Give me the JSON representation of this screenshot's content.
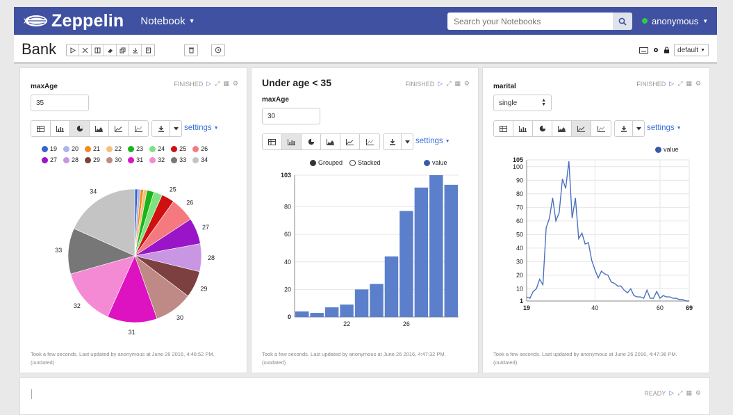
{
  "app": {
    "brand": "Zeppelin",
    "notebook_menu": "Notebook",
    "search_placeholder": "Search your Notebooks",
    "user": "anonymous"
  },
  "notebook": {
    "title": "Bank",
    "interpreter_default": "default"
  },
  "colors": {
    "navbar": "#3f51a0",
    "accent": "#3a6fd8",
    "bar": "#5b7fcb",
    "status_green": "#2ecc40"
  },
  "panels": [
    {
      "title": "",
      "status": "FINISHED",
      "form_label": "maxAge",
      "form_value": "35",
      "settings_label": "settings",
      "footer_line1": "Took a few seconds. Last updated by anonymous at June 26 2016, 4:46:52 PM.",
      "footer_line2": "(outdated)"
    },
    {
      "title": "Under age < 35",
      "status": "FINISHED",
      "form_label": "maxAge",
      "form_value": "30",
      "settings_label": "settings",
      "grouped_label": "Grouped",
      "stacked_label": "Stacked",
      "value_legend": "value",
      "footer_line1": "Took a few seconds. Last updated by anonymous at June 26 2016, 4:47:32 PM.",
      "footer_line2": "(outdated)"
    },
    {
      "title": "",
      "status": "FINISHED",
      "form_label": "marital",
      "form_value": "single",
      "settings_label": "settings",
      "value_legend": "value",
      "footer_line1": "Took a few seconds. Last updated by anonymous at June 26 2016, 4:47:36 PM.",
      "footer_line2": "(outdated)"
    }
  ],
  "bottom_panel": {
    "status": "READY"
  },
  "chart_data": [
    {
      "type": "pie",
      "categories": [
        "19",
        "20",
        "21",
        "22",
        "23",
        "24",
        "25",
        "26",
        "27",
        "28",
        "29",
        "30",
        "31",
        "32",
        "33",
        "34"
      ],
      "values": [
        0.5,
        0.5,
        0.5,
        0.6,
        1.2,
        1.5,
        2.2,
        4.2,
        4.5,
        4.8,
        4.6,
        6.6,
        8.6,
        9.9,
        7.9,
        13.0
      ],
      "colors": [
        "#3366cc",
        "#aab4ee",
        "#f28a1e",
        "#f5c07a",
        "#1ab41a",
        "#7ee37e",
        "#d01010",
        "#f57a80",
        "#9a14c8",
        "#c996e3",
        "#7c4040",
        "#bf8a85",
        "#dd12c0",
        "#f48ad4",
        "#777777",
        "#c4c4c4"
      ],
      "labels_shown": [
        "25",
        "26",
        "27",
        "28",
        "29",
        "30",
        "31",
        "32",
        "33",
        "34"
      ]
    },
    {
      "type": "bar",
      "x": [
        19,
        20,
        21,
        22,
        23,
        24,
        25,
        26,
        27,
        28,
        29
      ],
      "values": [
        4,
        3,
        7,
        9,
        20,
        24,
        44,
        77,
        94,
        103,
        96
      ],
      "ylim": [
        0,
        103
      ],
      "yticks": [
        0,
        20,
        40,
        60,
        80,
        103
      ],
      "xticks": [
        22,
        26
      ],
      "legend": "value"
    },
    {
      "type": "line",
      "x": [
        19,
        20,
        21,
        22,
        23,
        24,
        25,
        26,
        27,
        28,
        29,
        30,
        31,
        32,
        33,
        34,
        35,
        36,
        37,
        38,
        39,
        40,
        41,
        42,
        43,
        44,
        45,
        46,
        47,
        48,
        49,
        50,
        51,
        52,
        53,
        54,
        55,
        56,
        57,
        58,
        59,
        60,
        61,
        62,
        63,
        64,
        65,
        66,
        67,
        68,
        69
      ],
      "values": [
        4,
        3,
        8,
        10,
        17,
        13,
        55,
        62,
        77,
        60,
        66,
        91,
        84,
        104,
        62,
        77,
        47,
        51,
        43,
        44,
        31,
        24,
        18,
        23,
        21,
        20,
        15,
        14,
        12,
        12,
        9,
        7,
        10,
        5,
        4,
        4,
        3,
        9,
        3,
        3,
        8,
        3,
        5,
        4,
        4,
        3,
        3,
        2,
        2,
        1,
        1
      ],
      "ylim": [
        1,
        105
      ],
      "yticks": [
        1,
        10,
        20,
        30,
        40,
        50,
        60,
        70,
        80,
        90,
        100,
        105
      ],
      "xticks": [
        19,
        40,
        60,
        69
      ],
      "legend": "value"
    }
  ]
}
